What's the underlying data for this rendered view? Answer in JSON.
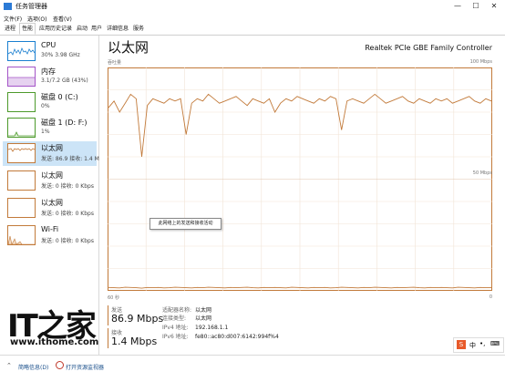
{
  "window": {
    "title": "任务管理器",
    "controls": [
      "—",
      "☐",
      "✕"
    ]
  },
  "menu": [
    "文件(F)",
    "选项(O)",
    "查看(V)"
  ],
  "tabs": [
    "进程",
    "性能",
    "应用历史记录",
    "启动",
    "用户",
    "详细信息",
    "服务"
  ],
  "active_tab": 1,
  "sidebar": {
    "items": [
      {
        "name": "CPU",
        "sub": "30% 3.98 GHz",
        "color": "#1a7fd0"
      },
      {
        "name": "内存",
        "sub": "3.1/7.2 GB (43%)",
        "color": "#a454c8"
      },
      {
        "name": "磁盘 0 (C:)",
        "sub": "0%",
        "color": "#4d9a2b"
      },
      {
        "name": "磁盘 1 (D: F:)",
        "sub": "1%",
        "color": "#4d9a2b"
      },
      {
        "name": "以太网",
        "sub": "发送: 86.9 接收: 1.4 M",
        "color": "#c27a3a"
      },
      {
        "name": "以太网",
        "sub": "发送: 0 接收: 0 Kbps",
        "color": "#c27a3a"
      },
      {
        "name": "以太网",
        "sub": "发送: 0 接收: 0 Kbps",
        "color": "#c27a3a"
      },
      {
        "name": "Wi-Fi",
        "sub": "发送: 0 接收: 0 Kbps",
        "color": "#c27a3a"
      }
    ],
    "selected_index": 4
  },
  "main": {
    "heading": "以太网",
    "adapter": "Realtek PCIe GBE Family Controller",
    "graph_label": "吞吐量",
    "max_label": "100 Mbps",
    "mid_label": "50 Mbps",
    "time_label": "60 秒",
    "zero_label": "0",
    "tooltip": "此网络上的发送和接收活动",
    "accent_color": "#c27a3a"
  },
  "stats": {
    "send_label": "发送",
    "send_value": "86.9 Mbps",
    "recv_label": "接收",
    "recv_value": "1.4 Mbps"
  },
  "properties": [
    {
      "key": "适配器名称:",
      "value": "以太网"
    },
    {
      "key": "连接类型:",
      "value": "以太网"
    },
    {
      "key": "IPv4 地址:",
      "value": "192.168.1.1"
    },
    {
      "key": "IPv6 地址:",
      "value": "fe80::ac80:d007:6142:994f%4"
    }
  ],
  "footer": {
    "fewer_details": "简略信息(D)",
    "open_monitor": "打开资源监视器"
  },
  "watermark": {
    "brand": "IT之家",
    "url": "www.ithome.com"
  },
  "ime": {
    "label": "中"
  },
  "chart_data": {
    "type": "line",
    "ylim": [
      0,
      100
    ],
    "unit": "Mbps",
    "series": [
      {
        "name": "发送",
        "values": [
          82,
          85,
          80,
          84,
          88,
          86,
          60,
          83,
          86,
          85,
          84,
          86,
          85,
          86,
          70,
          84,
          86,
          85,
          88,
          86,
          84,
          85,
          86,
          87,
          85,
          83,
          86,
          85,
          84,
          86,
          80,
          84,
          86,
          85,
          87,
          86,
          85,
          84,
          86,
          85,
          87,
          86,
          72,
          85,
          86,
          85,
          84,
          86,
          88,
          86,
          84,
          85,
          86,
          87,
          85,
          84,
          86,
          85,
          84,
          86,
          85,
          86,
          84,
          85,
          86,
          87,
          85,
          84,
          86,
          85
        ]
      },
      {
        "name": "接收",
        "values": [
          1.5,
          1.4,
          1.3,
          1.6,
          1.5,
          1.4,
          1.2,
          1.5,
          1.4,
          1.5,
          1.3,
          1.4,
          1.6,
          1.5,
          1.4,
          1.3,
          1.5,
          1.4,
          1.6,
          1.5,
          1.4,
          1.3,
          1.5,
          1.4,
          1.5,
          1.6,
          1.4,
          1.3,
          1.5,
          1.4,
          1.5,
          1.4,
          1.3,
          1.6,
          1.5,
          1.4,
          1.3,
          1.5,
          1.4,
          1.5,
          1.3,
          1.4,
          1.6,
          1.5,
          1.4,
          1.3,
          1.5,
          1.4,
          1.6,
          1.5,
          1.4,
          1.3,
          1.5,
          1.4,
          1.5,
          1.6,
          1.4,
          1.3,
          1.5,
          1.4,
          1.5,
          1.4,
          1.3,
          1.6,
          1.5,
          1.4,
          1.3,
          1.5,
          1.4,
          1.4
        ]
      }
    ]
  }
}
